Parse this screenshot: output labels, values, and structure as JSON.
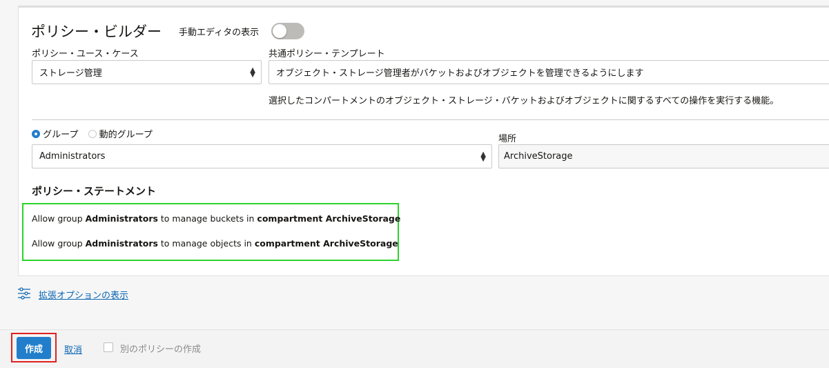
{
  "header": {
    "title": "ポリシー・ビルダー",
    "manual_editor_label": "手動エディタの表示",
    "manual_editor_on": false
  },
  "use_case": {
    "label": "ポリシー・ユース・ケース",
    "value": "ストレージ管理"
  },
  "template": {
    "label": "共通ポリシー・テンプレート",
    "value": "オブジェクト・ストレージ管理者がバケットおよびオブジェクトを管理できるようにします",
    "description": "選択したコンパートメントのオブジェクト・ストレージ・バケットおよびオブジェクトに関するすべての操作を実行する機能。"
  },
  "group_type": {
    "options": [
      "グループ",
      "動的グループ"
    ],
    "selected": "グループ"
  },
  "group": {
    "value": "Administrators"
  },
  "location": {
    "label": "場所",
    "value": "ArchiveStorage"
  },
  "statements": {
    "heading": "ポリシー・ステートメント",
    "lines": [
      {
        "p1": "Allow group ",
        "b1": "Administrators",
        "p2": " to manage buckets in ",
        "b2": "compartment ArchiveStorage"
      },
      {
        "p1": "Allow group ",
        "b1": "Administrators",
        "p2": " to manage objects in ",
        "b2": "compartment ArchiveStorage"
      }
    ]
  },
  "advanced": {
    "label": "拡張オプションの表示",
    "icon": "sliders-icon"
  },
  "footer": {
    "create_label": "作成",
    "cancel_label": "取消",
    "another_label": "別のポリシーの作成"
  },
  "colors": {
    "primary": "#227ecb",
    "highlight_green": "#2bd32b",
    "highlight_red": "#e02020",
    "link": "#0a66b3"
  }
}
